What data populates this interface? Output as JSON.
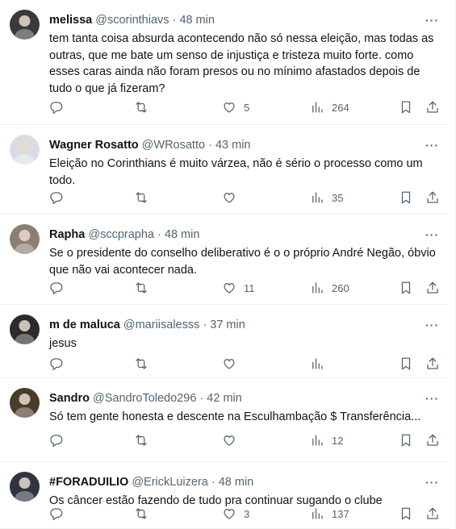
{
  "tweets": [
    {
      "name": "melissa",
      "handle": "@scorinthiavs",
      "sep": "·",
      "time": "48 min",
      "text": "tem tanta coisa absurda acontecendo não só nessa eleição, mas todas as outras, que me bate um senso de injustiça e tristeza muito forte. como esses caras ainda não foram presos ou no mínimo afastados depois de tudo o que já fizeram?",
      "likes": "5",
      "views": "264",
      "avatar_color": "#3a3a3a"
    },
    {
      "name": "Wagner Rosatto",
      "handle": "@WRosatto",
      "sep": "·",
      "time": "43 min",
      "text": "Eleição no Corinthians é muito várzea, não é sério o processo como um todo.",
      "likes": "",
      "views": "35",
      "avatar_color": "#d9dde3"
    },
    {
      "name": "Rapha",
      "handle": "@sccprapha",
      "sep": "·",
      "time": "48 min",
      "text": "Se o presidente do conselho deliberativo é o o próprio André Negão, óbvio que não vai acontecer nada.",
      "likes": "11",
      "views": "260",
      "avatar_color": "#8a7f70"
    },
    {
      "name": "m de maluca",
      "handle": "@mariisalesss",
      "sep": "·",
      "time": "37 min",
      "text": "jesus",
      "likes": "",
      "views": "",
      "avatar_color": "#2b2b2b"
    },
    {
      "name": "Sandro",
      "handle": "@SandroToledo296",
      "sep": "·",
      "time": "42 min",
      "text": "Só tem gente honesta e descente na Esculhambação $ Transferência...",
      "likes": "",
      "views": "12",
      "avatar_color": "#4a3b2a"
    },
    {
      "name": "#FORADUILIO",
      "handle": "@ErickLuizera",
      "sep": "·",
      "time": "48 min",
      "text": "Os câncer estão fazendo de tudo pra continuar sugando o clube",
      "likes": "3",
      "views": "137",
      "avatar_color": "#2f3440"
    }
  ],
  "more_glyph": "···",
  "icons": [
    "reply-icon",
    "retweet-icon",
    "like-icon",
    "views-icon",
    "bookmark-icon",
    "share-icon"
  ]
}
